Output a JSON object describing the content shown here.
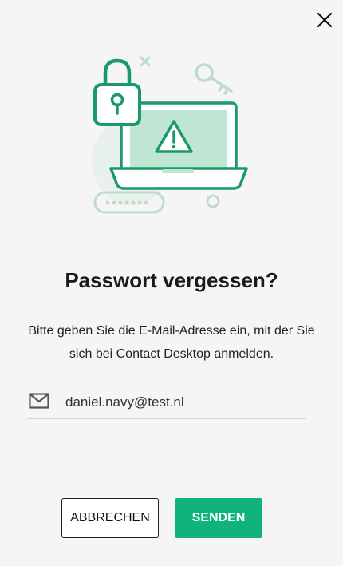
{
  "dialog": {
    "title": "Passwort vergessen?",
    "description": "Bitte geben Sie die E-Mail-Adresse ein, mit der Sie sich bei Contact Desktop anmelden.",
    "email": {
      "value": "daniel.navy@test.nl",
      "icon": "mail-icon"
    },
    "buttons": {
      "cancel": "ABBRECHEN",
      "send": "SENDEN"
    },
    "close_icon": "close-icon"
  },
  "colors": {
    "accent": "#0fb37b",
    "illustration_green": "#1a9a6c",
    "background": "#f5f5f5"
  }
}
